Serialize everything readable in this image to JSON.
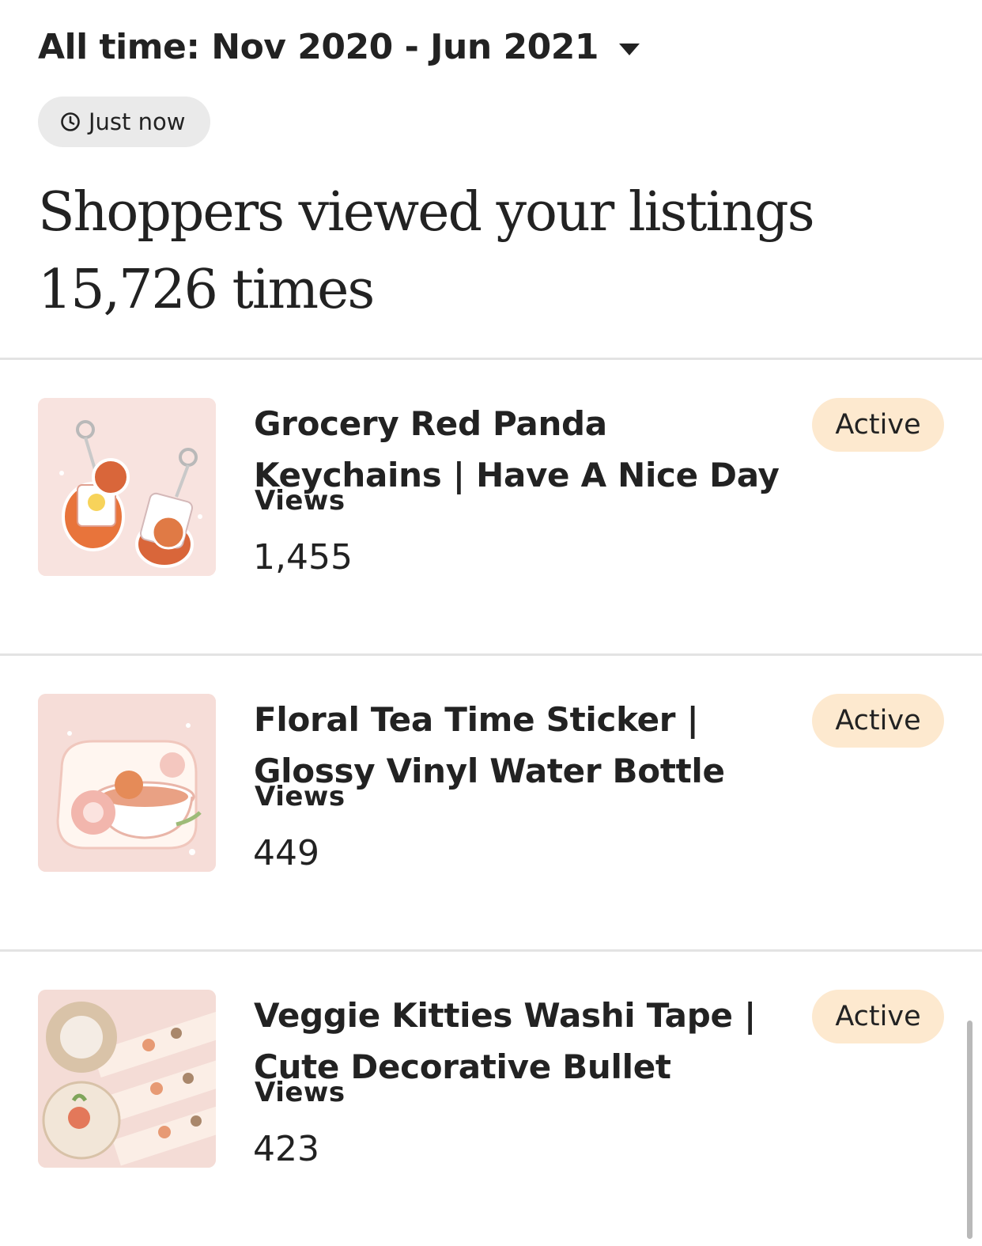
{
  "header": {
    "date_range_label": "All time: Nov 2020 - Jun 2021",
    "refresh_label": "Just now"
  },
  "summary": {
    "line1": "Shoppers viewed your listings",
    "line2": "15,726 times"
  },
  "listings": [
    {
      "title_line1": "Grocery Red Panda",
      "title_line2": "Keychains | Have A Nice Day",
      "views_label": "Views",
      "views": "1,455",
      "status": "Active"
    },
    {
      "title_line1": "Floral Tea Time Sticker |",
      "title_line2": "Glossy Vinyl Water Bottle",
      "views_label": "Views",
      "views": "449",
      "status": "Active"
    },
    {
      "title_line1": "Veggie Kitties Washi Tape |",
      "title_line2": "Cute Decorative Bullet",
      "views_label": "Views",
      "views": "423",
      "status": "Active"
    }
  ],
  "colors": {
    "text": "#222222",
    "pill_bg": "#eaeaea",
    "badge_bg": "#fde9cf",
    "divider": "#e3e3e3"
  },
  "icons": {
    "clock": "clock-icon",
    "dropdown": "caret-down-icon"
  }
}
